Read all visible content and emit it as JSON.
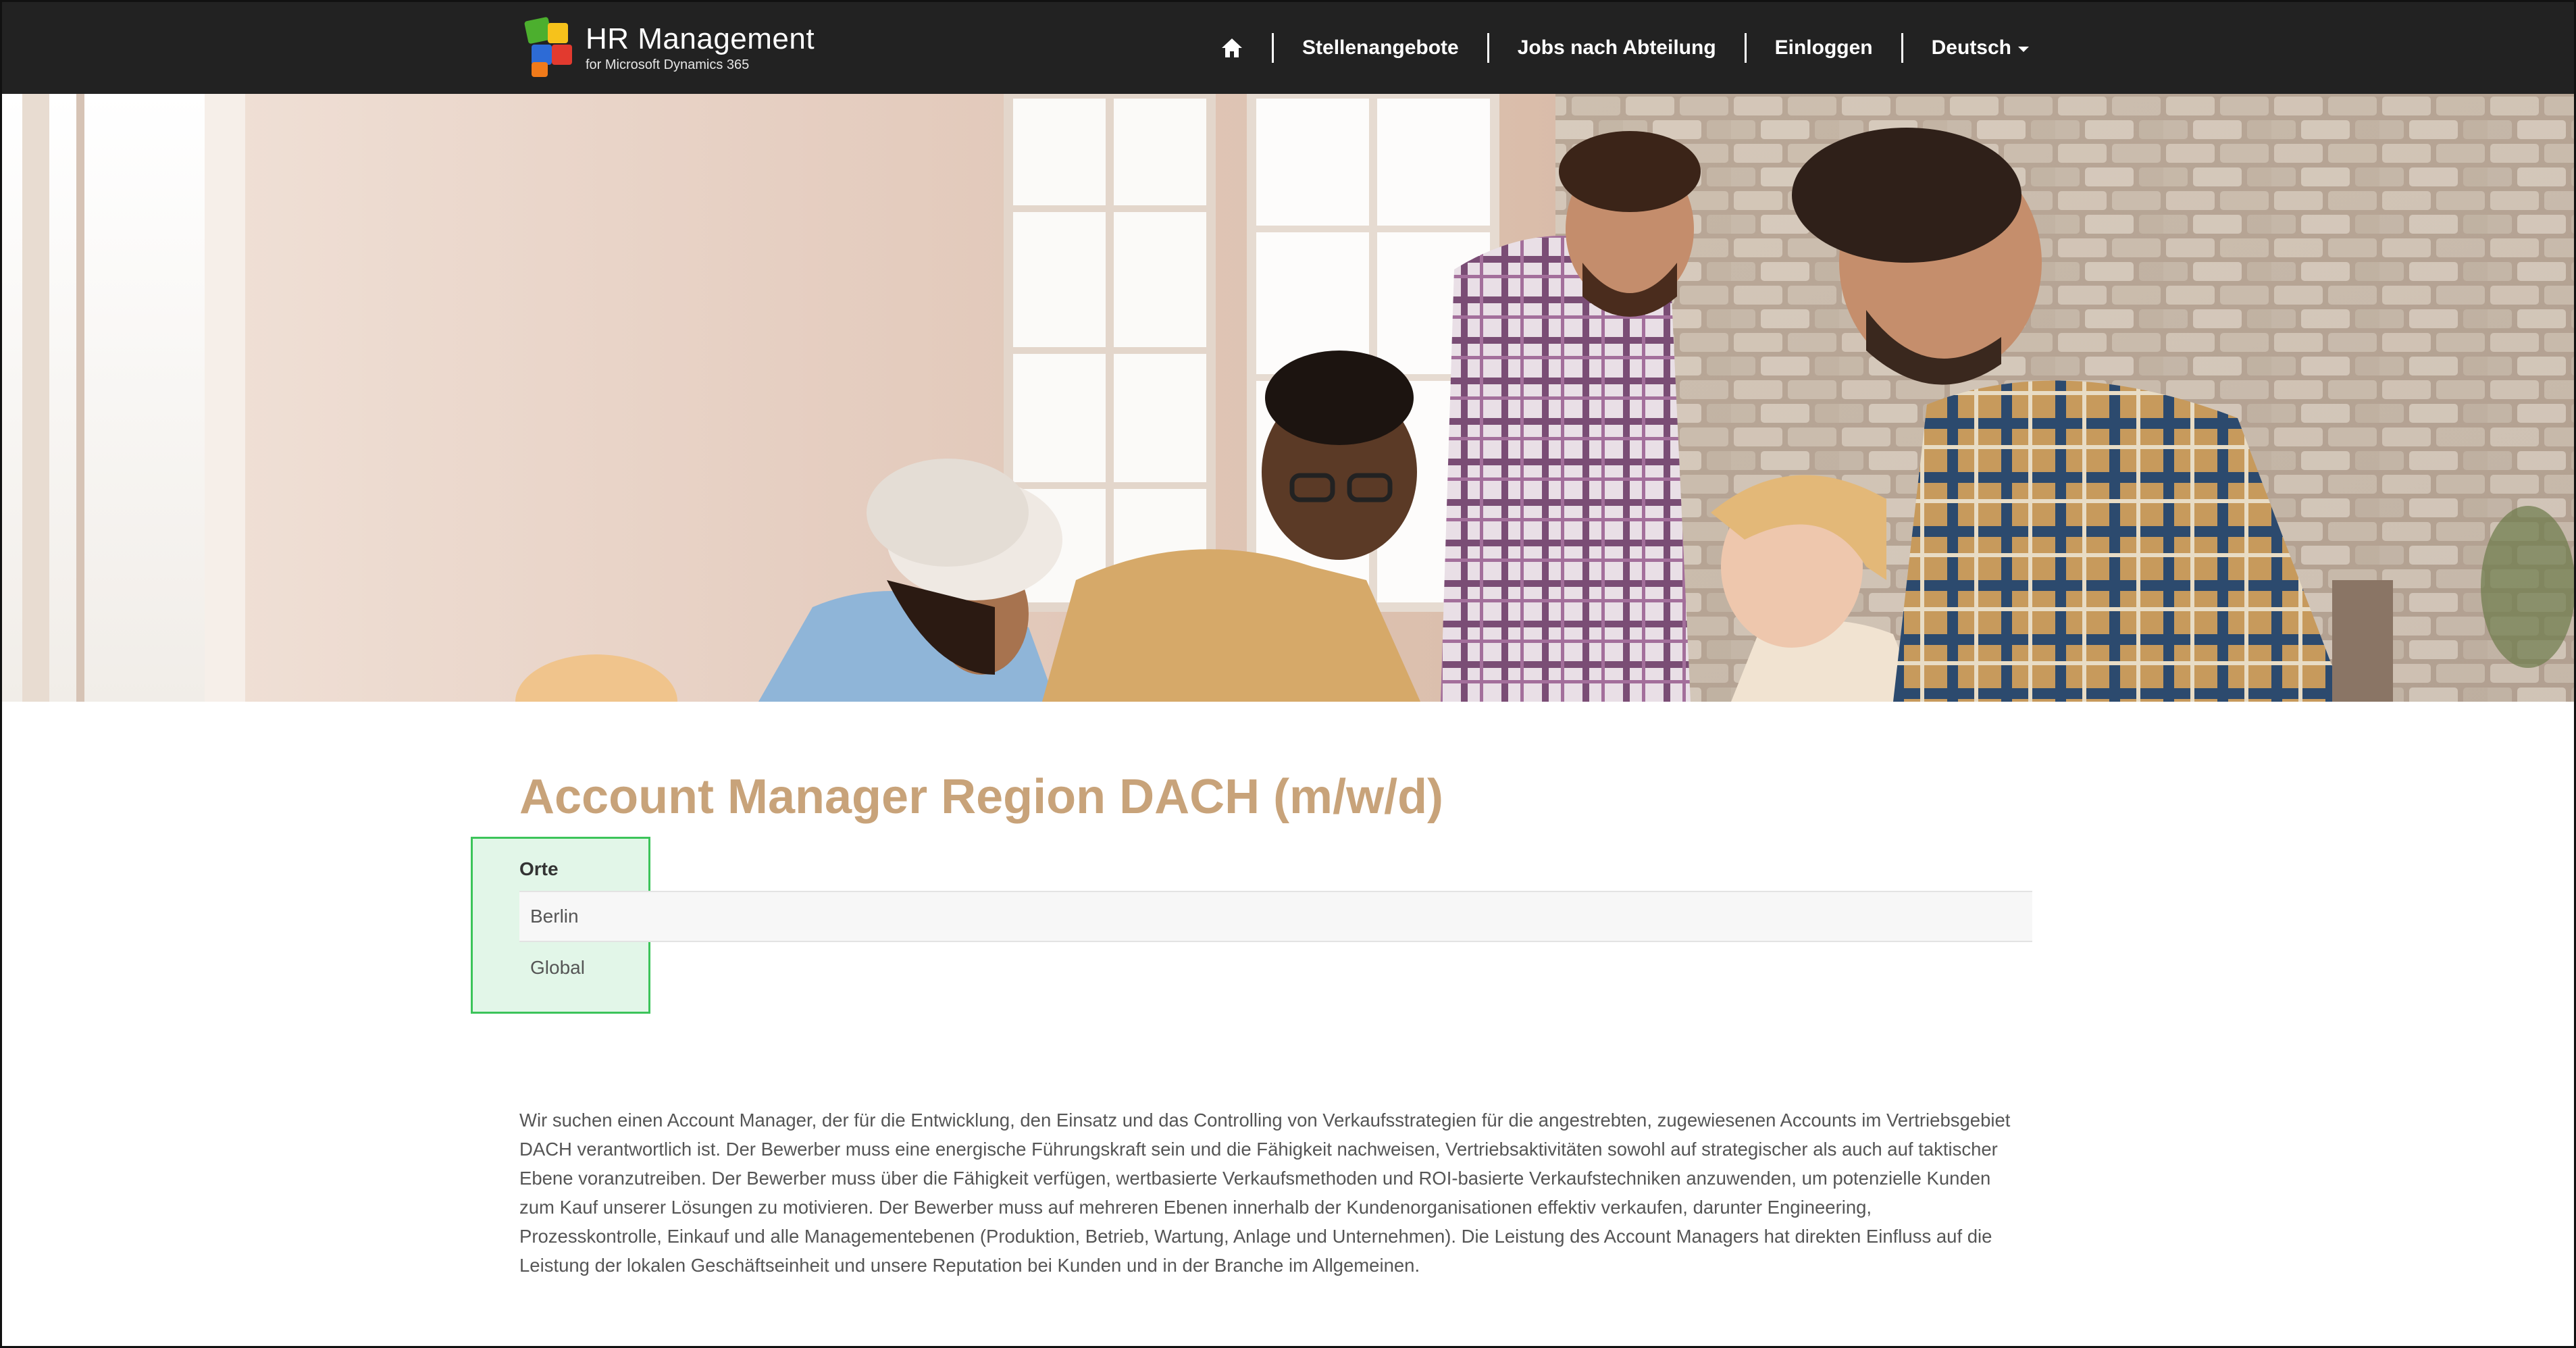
{
  "brand": {
    "title": "HR Management",
    "subtitle": "for Microsoft Dynamics 365"
  },
  "nav": {
    "home_icon": "home-icon",
    "items": [
      {
        "label": "Stellenangebote"
      },
      {
        "label": "Jobs nach Abteilung"
      },
      {
        "label": "Einloggen"
      },
      {
        "label": "Deutsch"
      }
    ]
  },
  "job": {
    "title": "Account Manager Region DACH (m/w/d)",
    "locations_heading": "Orte",
    "locations": [
      "Berlin",
      "Global"
    ],
    "description": "Wir suchen einen Account Manager, der für die Entwicklung, den Einsatz und das Controlling von Verkaufsstrategien für die angestrebten, zugewiesenen Accounts im Vertriebsgebiet DACH verantwortlich ist. Der Bewerber muss eine energische Führungskraft sein und die Fähigkeit nachweisen, Vertriebsaktivitäten sowohl auf strategischer als auch auf taktischer Ebene voranzutreiben. Der Bewerber muss über die Fähigkeit verfügen, wertbasierte Verkaufsmethoden und ROI-basierte Verkaufstechniken anzuwenden, um potenzielle Kunden zum Kauf unserer Lösungen zu motivieren. Der Bewerber muss auf mehreren Ebenen innerhalb der Kundenorganisationen effektiv verkaufen, darunter Engineering, Prozesskontrolle, Einkauf und alle Managementebenen (Produktion, Betrieb, Wartung, Anlage und Unternehmen). Die Leistung des Account Managers hat direkten Einfluss auf die Leistung der lokalen Geschäftseinheit und unsere Reputation bei Kunden und in der Branche im Allgemeinen."
  },
  "colors": {
    "navbar": "#222222",
    "title": "#c8a37a",
    "highlight_border": "#3cc45a"
  }
}
